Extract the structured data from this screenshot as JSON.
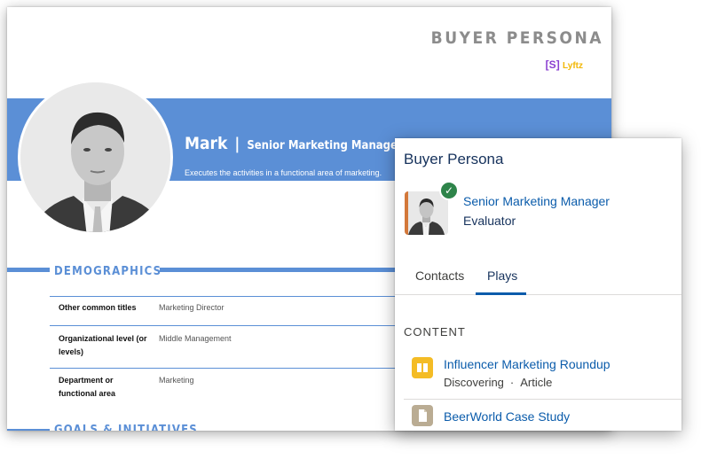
{
  "document": {
    "title": "BUYER PERSONA",
    "logo": {
      "bracket_open": "[",
      "s": "S",
      "bracket_close": "]",
      "word": "Lyftz"
    },
    "persona": {
      "name": "Mark",
      "separator": "|",
      "title": "Senior Marketing Manager",
      "description": "Executes the activities in a functional area of marketing."
    },
    "sections": {
      "demographics": "DEMOGRAPHICS",
      "goals": "GOALS & INITIATIVES"
    },
    "demographics": [
      {
        "label": "Other common titles",
        "value": "Marketing Director"
      },
      {
        "label": "Organizational level (or levels)",
        "value": "Middle Management"
      },
      {
        "label": "Department or functional area",
        "value": "Marketing"
      }
    ],
    "colors": {
      "accent": "#5b8fd6",
      "title_gray": "#8c8c8c"
    }
  },
  "card": {
    "title": "Buyer Persona",
    "role": "Senior Marketing Manager",
    "sub": "Evaluator",
    "tabs": [
      {
        "label": "Contacts",
        "active": false
      },
      {
        "label": "Plays",
        "active": true
      }
    ],
    "section": "CONTENT",
    "items": [
      {
        "icon": "book-icon",
        "title": "Influencer Marketing Roundup",
        "stage": "Discovering",
        "type": "Article"
      },
      {
        "icon": "document-icon",
        "title": "BeerWorld Case Study"
      }
    ],
    "colors": {
      "link": "#0b5cab",
      "text": "#16325c",
      "check": "#2e844a"
    }
  }
}
